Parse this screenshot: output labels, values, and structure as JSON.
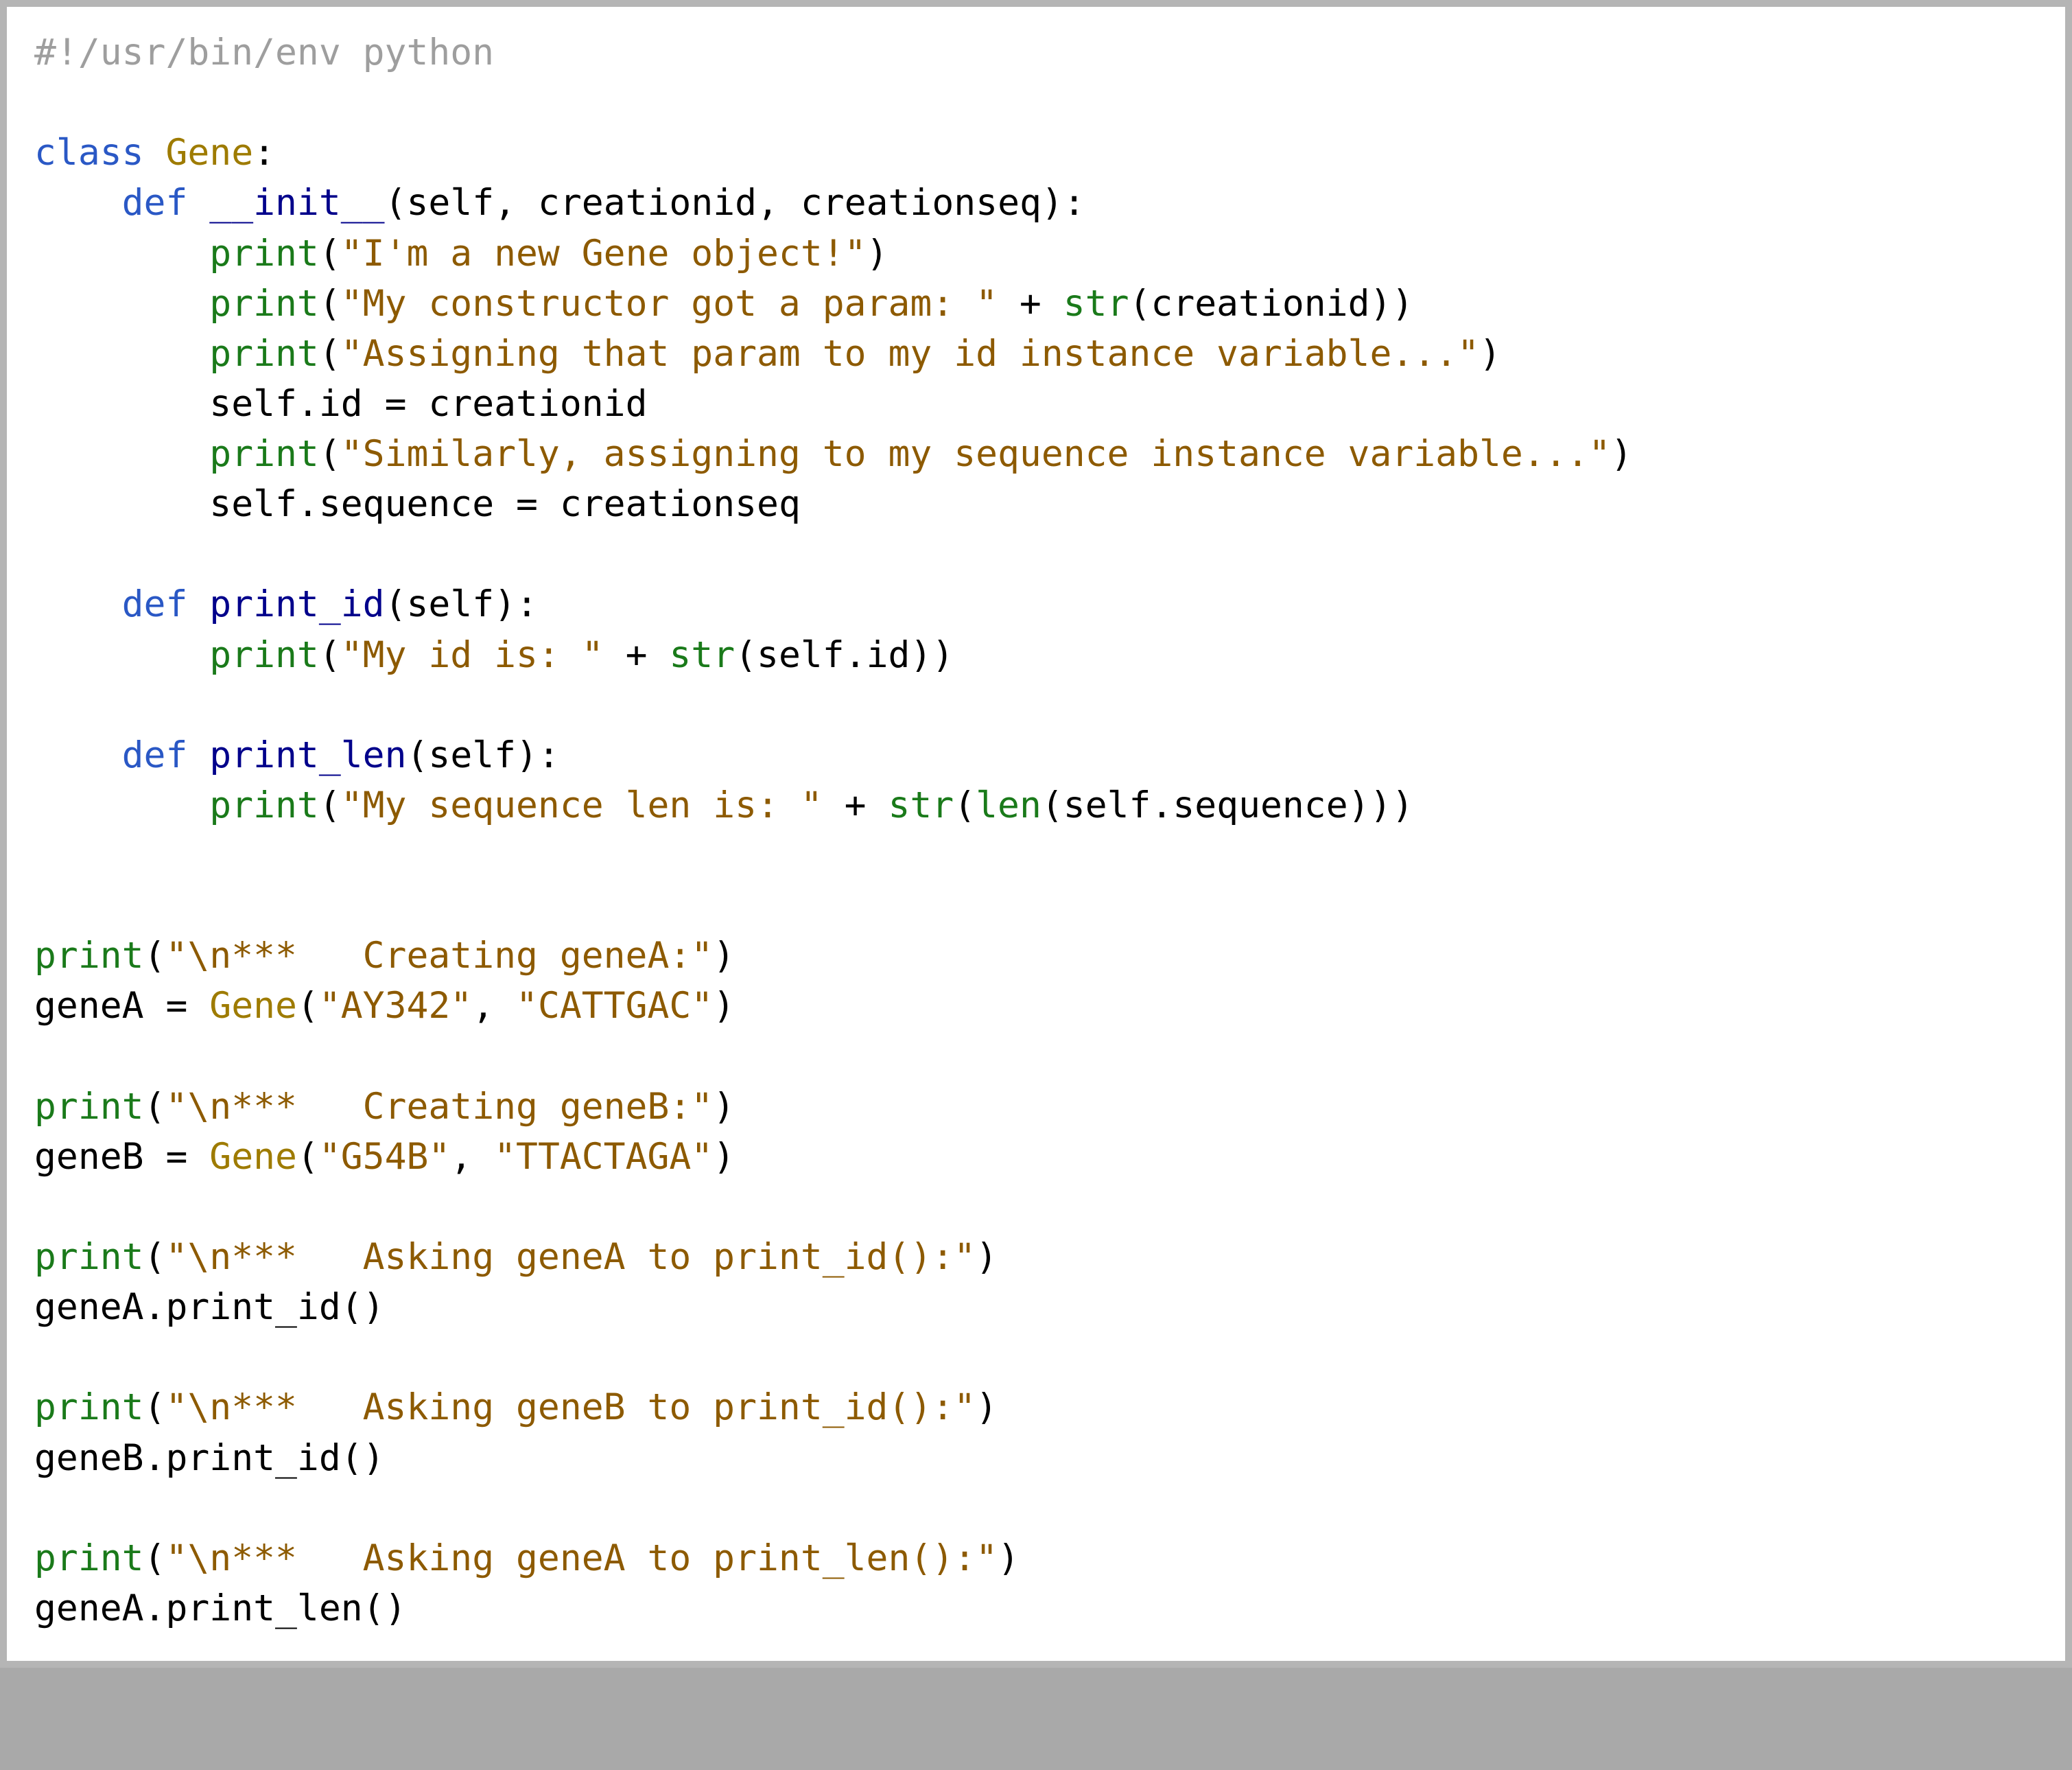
{
  "code": {
    "lines": [
      [
        {
          "cls": "c-comment",
          "t": "#!/usr/bin/env python"
        }
      ],
      [
        {
          "cls": "",
          "t": ""
        }
      ],
      [
        {
          "cls": "c-keyword",
          "t": "class"
        },
        {
          "cls": "c-punct",
          "t": " "
        },
        {
          "cls": "c-classname",
          "t": "Gene"
        },
        {
          "cls": "c-punct",
          "t": ":"
        }
      ],
      [
        {
          "cls": "c-punct",
          "t": "    "
        },
        {
          "cls": "c-keyword",
          "t": "def"
        },
        {
          "cls": "c-punct",
          "t": " "
        },
        {
          "cls": "c-funcname",
          "t": "__init__"
        },
        {
          "cls": "c-punct",
          "t": "("
        },
        {
          "cls": "c-self",
          "t": "self"
        },
        {
          "cls": "c-punct",
          "t": ", "
        },
        {
          "cls": "c-ident",
          "t": "creationid"
        },
        {
          "cls": "c-punct",
          "t": ", "
        },
        {
          "cls": "c-ident",
          "t": "creationseq"
        },
        {
          "cls": "c-punct",
          "t": "):"
        }
      ],
      [
        {
          "cls": "c-punct",
          "t": "        "
        },
        {
          "cls": "c-builtin",
          "t": "print"
        },
        {
          "cls": "c-punct",
          "t": "("
        },
        {
          "cls": "c-string",
          "t": "\"I'm a new Gene object!\""
        },
        {
          "cls": "c-punct",
          "t": ")"
        }
      ],
      [
        {
          "cls": "c-punct",
          "t": "        "
        },
        {
          "cls": "c-builtin",
          "t": "print"
        },
        {
          "cls": "c-punct",
          "t": "("
        },
        {
          "cls": "c-string",
          "t": "\"My constructor got a param: \""
        },
        {
          "cls": "c-punct",
          "t": " + "
        },
        {
          "cls": "c-builtin",
          "t": "str"
        },
        {
          "cls": "c-punct",
          "t": "("
        },
        {
          "cls": "c-ident",
          "t": "creationid"
        },
        {
          "cls": "c-punct",
          "t": "))"
        }
      ],
      [
        {
          "cls": "c-punct",
          "t": "        "
        },
        {
          "cls": "c-builtin",
          "t": "print"
        },
        {
          "cls": "c-punct",
          "t": "("
        },
        {
          "cls": "c-string",
          "t": "\"Assigning that param to my id instance variable...\""
        },
        {
          "cls": "c-punct",
          "t": ")"
        }
      ],
      [
        {
          "cls": "c-punct",
          "t": "        "
        },
        {
          "cls": "c-self",
          "t": "self"
        },
        {
          "cls": "c-punct",
          "t": "."
        },
        {
          "cls": "c-attr",
          "t": "id"
        },
        {
          "cls": "c-punct",
          "t": " = "
        },
        {
          "cls": "c-ident",
          "t": "creationid"
        }
      ],
      [
        {
          "cls": "c-punct",
          "t": "        "
        },
        {
          "cls": "c-builtin",
          "t": "print"
        },
        {
          "cls": "c-punct",
          "t": "("
        },
        {
          "cls": "c-string",
          "t": "\"Similarly, assigning to my sequence instance variable...\""
        },
        {
          "cls": "c-punct",
          "t": ")"
        }
      ],
      [
        {
          "cls": "c-punct",
          "t": "        "
        },
        {
          "cls": "c-self",
          "t": "self"
        },
        {
          "cls": "c-punct",
          "t": "."
        },
        {
          "cls": "c-attr",
          "t": "sequence"
        },
        {
          "cls": "c-punct",
          "t": " = "
        },
        {
          "cls": "c-ident",
          "t": "creationseq"
        }
      ],
      [
        {
          "cls": "",
          "t": ""
        }
      ],
      [
        {
          "cls": "c-punct",
          "t": "    "
        },
        {
          "cls": "c-keyword",
          "t": "def"
        },
        {
          "cls": "c-punct",
          "t": " "
        },
        {
          "cls": "c-funcname",
          "t": "print_id"
        },
        {
          "cls": "c-punct",
          "t": "("
        },
        {
          "cls": "c-self",
          "t": "self"
        },
        {
          "cls": "c-punct",
          "t": "):"
        }
      ],
      [
        {
          "cls": "c-punct",
          "t": "        "
        },
        {
          "cls": "c-builtin",
          "t": "print"
        },
        {
          "cls": "c-punct",
          "t": "("
        },
        {
          "cls": "c-string",
          "t": "\"My id is: \""
        },
        {
          "cls": "c-punct",
          "t": " + "
        },
        {
          "cls": "c-builtin",
          "t": "str"
        },
        {
          "cls": "c-punct",
          "t": "("
        },
        {
          "cls": "c-self",
          "t": "self"
        },
        {
          "cls": "c-punct",
          "t": "."
        },
        {
          "cls": "c-attr",
          "t": "id"
        },
        {
          "cls": "c-punct",
          "t": "))"
        }
      ],
      [
        {
          "cls": "",
          "t": ""
        }
      ],
      [
        {
          "cls": "c-punct",
          "t": "    "
        },
        {
          "cls": "c-keyword",
          "t": "def"
        },
        {
          "cls": "c-punct",
          "t": " "
        },
        {
          "cls": "c-funcname",
          "t": "print_len"
        },
        {
          "cls": "c-punct",
          "t": "("
        },
        {
          "cls": "c-self",
          "t": "self"
        },
        {
          "cls": "c-punct",
          "t": "):"
        }
      ],
      [
        {
          "cls": "c-punct",
          "t": "        "
        },
        {
          "cls": "c-builtin",
          "t": "print"
        },
        {
          "cls": "c-punct",
          "t": "("
        },
        {
          "cls": "c-string",
          "t": "\"My sequence len is: \""
        },
        {
          "cls": "c-punct",
          "t": " + "
        },
        {
          "cls": "c-builtin",
          "t": "str"
        },
        {
          "cls": "c-punct",
          "t": "("
        },
        {
          "cls": "c-builtin",
          "t": "len"
        },
        {
          "cls": "c-punct",
          "t": "("
        },
        {
          "cls": "c-self",
          "t": "self"
        },
        {
          "cls": "c-punct",
          "t": "."
        },
        {
          "cls": "c-attr",
          "t": "sequence"
        },
        {
          "cls": "c-punct",
          "t": ")))"
        }
      ],
      [
        {
          "cls": "",
          "t": ""
        }
      ],
      [
        {
          "cls": "",
          "t": ""
        }
      ],
      [
        {
          "cls": "c-builtin",
          "t": "print"
        },
        {
          "cls": "c-punct",
          "t": "("
        },
        {
          "cls": "c-string",
          "t": "\"\\n***   Creating geneA:\""
        },
        {
          "cls": "c-punct",
          "t": ")"
        }
      ],
      [
        {
          "cls": "c-ident",
          "t": "geneA"
        },
        {
          "cls": "c-punct",
          "t": " = "
        },
        {
          "cls": "c-classname",
          "t": "Gene"
        },
        {
          "cls": "c-punct",
          "t": "("
        },
        {
          "cls": "c-string",
          "t": "\"AY342\""
        },
        {
          "cls": "c-punct",
          "t": ", "
        },
        {
          "cls": "c-string",
          "t": "\"CATTGAC\""
        },
        {
          "cls": "c-punct",
          "t": ")"
        }
      ],
      [
        {
          "cls": "",
          "t": ""
        }
      ],
      [
        {
          "cls": "c-builtin",
          "t": "print"
        },
        {
          "cls": "c-punct",
          "t": "("
        },
        {
          "cls": "c-string",
          "t": "\"\\n***   Creating geneB:\""
        },
        {
          "cls": "c-punct",
          "t": ")"
        }
      ],
      [
        {
          "cls": "c-ident",
          "t": "geneB"
        },
        {
          "cls": "c-punct",
          "t": " = "
        },
        {
          "cls": "c-classname",
          "t": "Gene"
        },
        {
          "cls": "c-punct",
          "t": "("
        },
        {
          "cls": "c-string",
          "t": "\"G54B\""
        },
        {
          "cls": "c-punct",
          "t": ", "
        },
        {
          "cls": "c-string",
          "t": "\"TTACTAGA\""
        },
        {
          "cls": "c-punct",
          "t": ")"
        }
      ],
      [
        {
          "cls": "",
          "t": ""
        }
      ],
      [
        {
          "cls": "c-builtin",
          "t": "print"
        },
        {
          "cls": "c-punct",
          "t": "("
        },
        {
          "cls": "c-string",
          "t": "\"\\n***   Asking geneA to print_id():\""
        },
        {
          "cls": "c-punct",
          "t": ")"
        }
      ],
      [
        {
          "cls": "c-ident",
          "t": "geneA"
        },
        {
          "cls": "c-punct",
          "t": "."
        },
        {
          "cls": "c-attr",
          "t": "print_id"
        },
        {
          "cls": "c-punct",
          "t": "()"
        }
      ],
      [
        {
          "cls": "",
          "t": ""
        }
      ],
      [
        {
          "cls": "c-builtin",
          "t": "print"
        },
        {
          "cls": "c-punct",
          "t": "("
        },
        {
          "cls": "c-string",
          "t": "\"\\n***   Asking geneB to print_id():\""
        },
        {
          "cls": "c-punct",
          "t": ")"
        }
      ],
      [
        {
          "cls": "c-ident",
          "t": "geneB"
        },
        {
          "cls": "c-punct",
          "t": "."
        },
        {
          "cls": "c-attr",
          "t": "print_id"
        },
        {
          "cls": "c-punct",
          "t": "()"
        }
      ],
      [
        {
          "cls": "",
          "t": ""
        }
      ],
      [
        {
          "cls": "c-builtin",
          "t": "print"
        },
        {
          "cls": "c-punct",
          "t": "("
        },
        {
          "cls": "c-string",
          "t": "\"\\n***   Asking geneA to print_len():\""
        },
        {
          "cls": "c-punct",
          "t": ")"
        }
      ],
      [
        {
          "cls": "c-ident",
          "t": "geneA"
        },
        {
          "cls": "c-punct",
          "t": "."
        },
        {
          "cls": "c-attr",
          "t": "print_len"
        },
        {
          "cls": "c-punct",
          "t": "()"
        }
      ]
    ]
  }
}
